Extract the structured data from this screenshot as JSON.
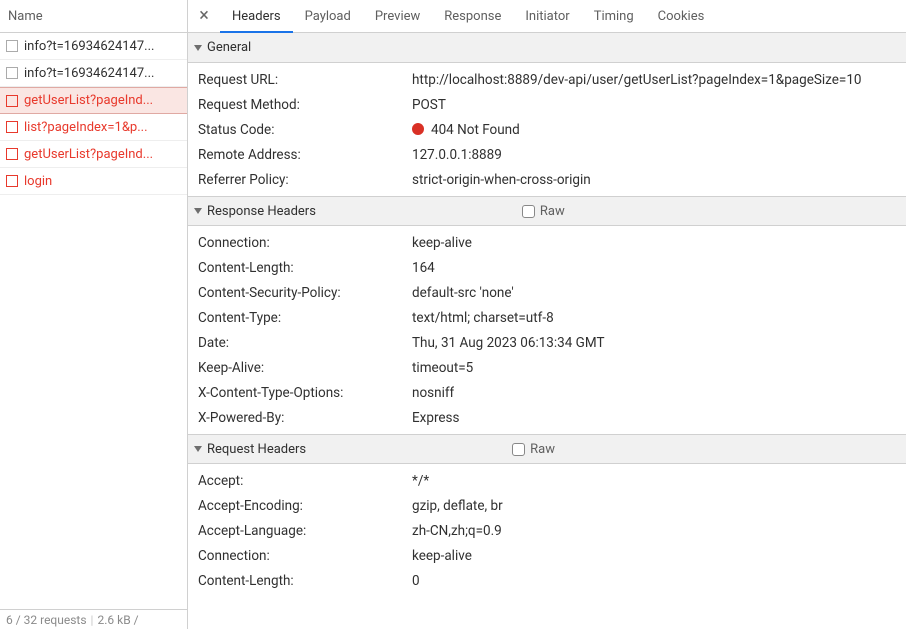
{
  "left": {
    "header": "Name",
    "requests": [
      {
        "name": "info?t=16934624147...",
        "err": false,
        "selected": false
      },
      {
        "name": "info?t=16934624147...",
        "err": false,
        "selected": false
      },
      {
        "name": "getUserList?pageInd...",
        "err": true,
        "selected": true
      },
      {
        "name": "list?pageIndex=1&p...",
        "err": true,
        "selected": false
      },
      {
        "name": "getUserList?pageInd...",
        "err": true,
        "selected": false
      },
      {
        "name": "login",
        "err": true,
        "selected": false
      }
    ],
    "footer": {
      "requests": "6 / 32 requests",
      "size": "2.6 kB /"
    }
  },
  "tabs": {
    "items": [
      "Headers",
      "Payload",
      "Preview",
      "Response",
      "Initiator",
      "Timing",
      "Cookies"
    ],
    "activeIndex": 0,
    "close": "×"
  },
  "general": {
    "title": "General",
    "rows": [
      {
        "k": "Request URL:",
        "v": "http://localhost:8889/dev-api/user/getUserList?pageIndex=1&pageSize=10"
      },
      {
        "k": "Request Method:",
        "v": "POST"
      },
      {
        "k": "Status Code:",
        "v": "404 Not Found",
        "status": true
      },
      {
        "k": "Remote Address:",
        "v": "127.0.0.1:8889"
      },
      {
        "k": "Referrer Policy:",
        "v": "strict-origin-when-cross-origin"
      }
    ]
  },
  "responseHeaders": {
    "title": "Response Headers",
    "rawLabel": "Raw",
    "rows": [
      {
        "k": "Connection:",
        "v": "keep-alive"
      },
      {
        "k": "Content-Length:",
        "v": "164"
      },
      {
        "k": "Content-Security-Policy:",
        "v": "default-src 'none'"
      },
      {
        "k": "Content-Type:",
        "v": "text/html; charset=utf-8"
      },
      {
        "k": "Date:",
        "v": "Thu, 31 Aug 2023 06:13:34 GMT"
      },
      {
        "k": "Keep-Alive:",
        "v": "timeout=5"
      },
      {
        "k": "X-Content-Type-Options:",
        "v": "nosniff"
      },
      {
        "k": "X-Powered-By:",
        "v": "Express"
      }
    ]
  },
  "requestHeaders": {
    "title": "Request Headers",
    "rawLabel": "Raw",
    "rows": [
      {
        "k": "Accept:",
        "v": "*/*"
      },
      {
        "k": "Accept-Encoding:",
        "v": "gzip, deflate, br"
      },
      {
        "k": "Accept-Language:",
        "v": "zh-CN,zh;q=0.9"
      },
      {
        "k": "Connection:",
        "v": "keep-alive"
      },
      {
        "k": "Content-Length:",
        "v": "0"
      }
    ]
  }
}
